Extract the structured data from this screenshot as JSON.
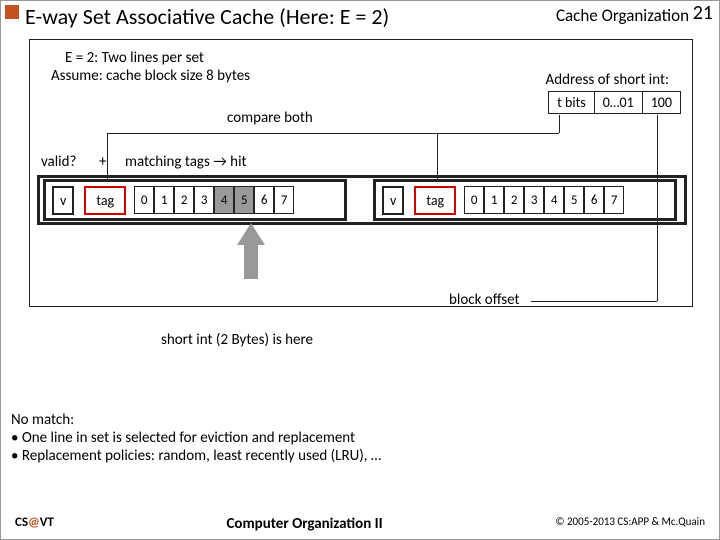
{
  "title": "E-way Set Associative Cache (Here: E = 2)",
  "topic": "Cache Organization",
  "page": "21",
  "sub1": "E = 2: Two lines per set",
  "sub2": "Assume: cache block size 8 bytes",
  "addr_label": "Address of short int:",
  "addr": {
    "tbits": "t bits",
    "mid": "0…01",
    "off": "100"
  },
  "compare": "compare both",
  "valid": "valid?",
  "plus": "+",
  "matching": "matching tags → hit",
  "v": "v",
  "tag": "tag",
  "bytes": [
    "0",
    "1",
    "2",
    "3",
    "4",
    "5",
    "6",
    "7"
  ],
  "block_offset": "block offset",
  "short_here": "short int (2 Bytes) is here",
  "nomatch": {
    "h": "No match:",
    "l1": "• One line in set is selected for eviction and replacement",
    "l2": "• Replacement policies: random, least recently used (LRU), …"
  },
  "footer": {
    "cs1": "CS",
    "csat": "@",
    "cs2": "VT",
    "course": "Computer Organization II",
    "copy": "© 2005-2013 CS:APP & Mc.Quain"
  }
}
